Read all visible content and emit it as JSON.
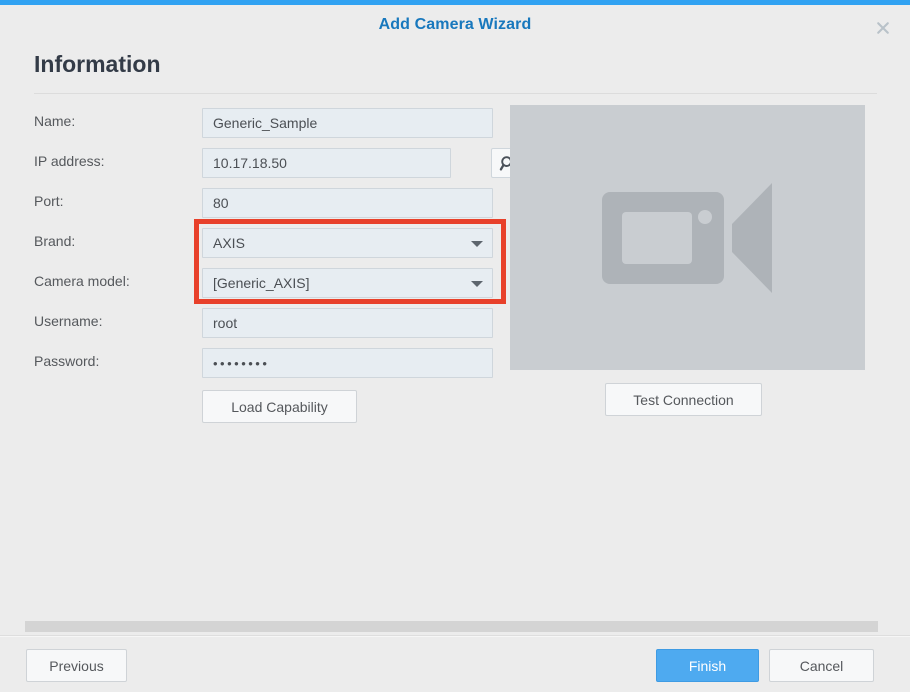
{
  "window": {
    "title": "Add Camera Wizard",
    "close_icon": "close-icon",
    "accent_color": "#31a2f2",
    "title_color": "#1878bd"
  },
  "page": {
    "heading": "Information"
  },
  "form": {
    "fields": [
      {
        "label": "Name:",
        "value": "Generic_Sample",
        "type": "text"
      },
      {
        "label": "IP address:",
        "value": "10.17.18.50",
        "type": "text-with-search",
        "search_icon": "search-icon"
      },
      {
        "label": "Port:",
        "value": "80",
        "type": "text"
      },
      {
        "label": "Brand:",
        "value": "AXIS",
        "type": "select"
      },
      {
        "label": "Camera model:",
        "value": "[Generic_AXIS]",
        "type": "select"
      },
      {
        "label": "Username:",
        "value": "root",
        "type": "text"
      },
      {
        "label": "Password:",
        "value": "••••••••",
        "type": "password"
      }
    ],
    "load_capability_label": "Load Capability"
  },
  "preview": {
    "placeholder_icon": "camera-icon",
    "test_connection_label": "Test Connection",
    "background_color": "#c9cdd1"
  },
  "annotation": {
    "color": "#e8402a",
    "targets": [
      "Brand:",
      "Camera model:"
    ]
  },
  "footer": {
    "previous_label": "Previous",
    "finish_label": "Finish",
    "cancel_label": "Cancel",
    "finish_color": "#4eaaf0"
  }
}
